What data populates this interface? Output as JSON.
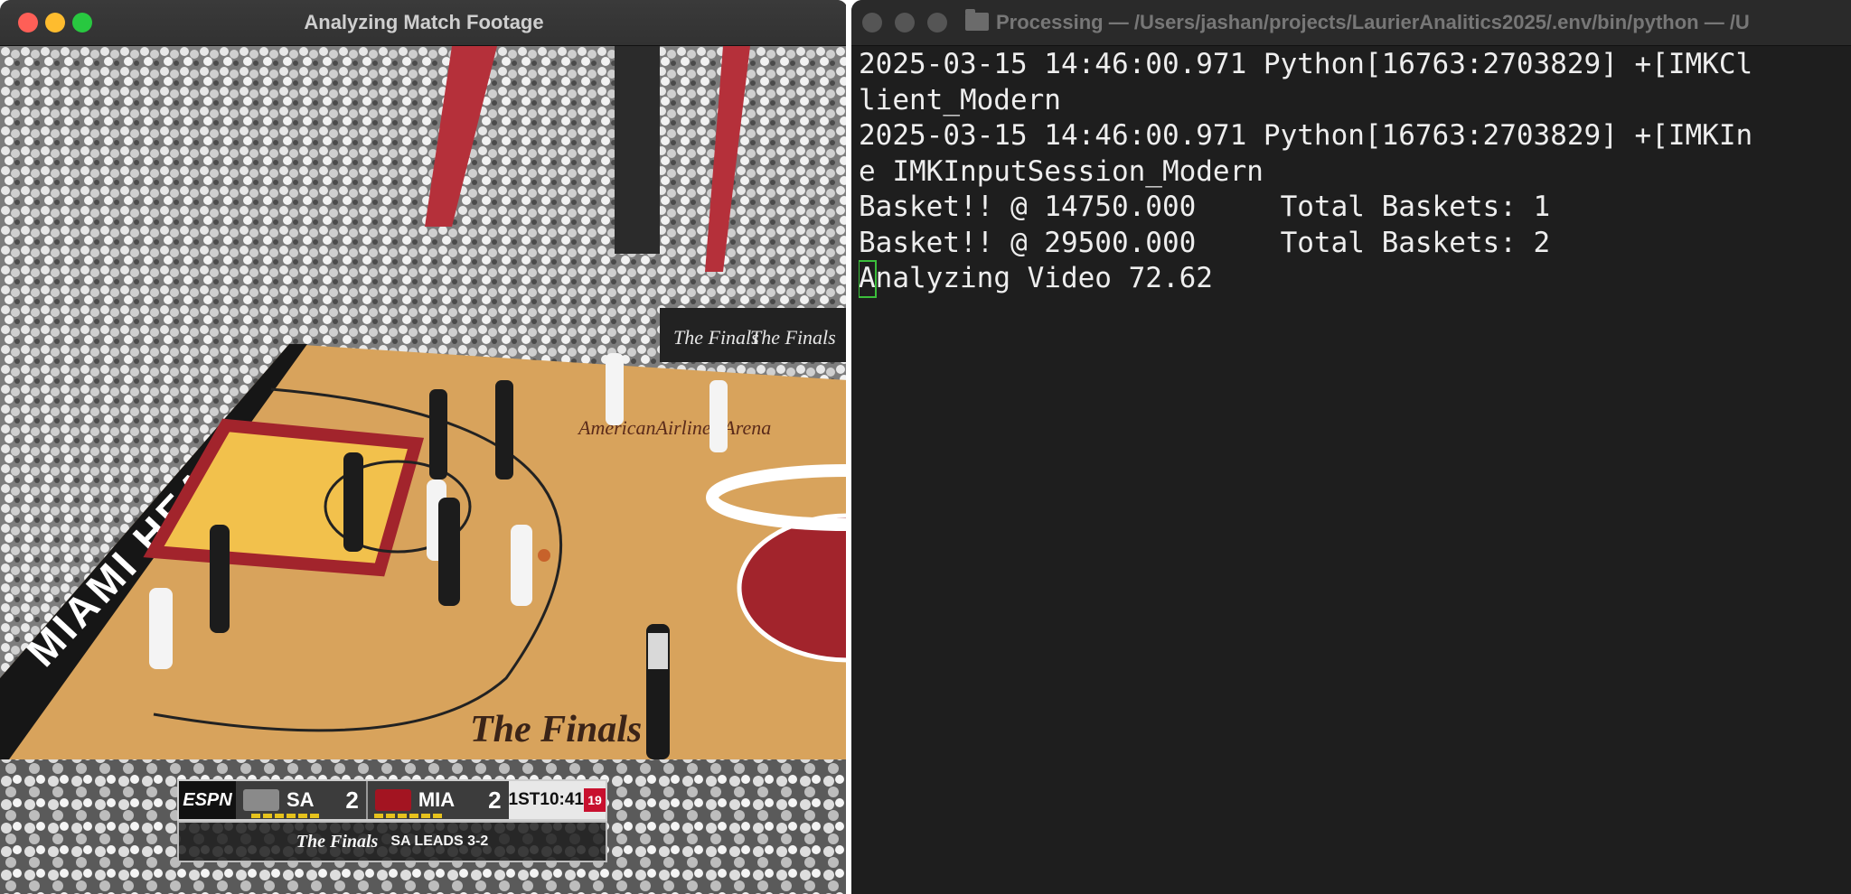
{
  "video_window": {
    "title": "Analyzing Match Footage",
    "court_text": {
      "baseline": "MIAMI HEAT",
      "center": "The Finals",
      "arena": "AmericanAirlines Arena",
      "sign_1": "The Finals",
      "sign_2": "The Finals"
    },
    "scorebug": {
      "network": "ESPN",
      "team_1": "SA",
      "score_1": "2",
      "team_2": "MIA",
      "score_2": "2",
      "period": "1ST",
      "clock": "10:41",
      "shot_clock": "19",
      "series_logo": "The Finals",
      "series_status": "SA LEADS 3-2"
    }
  },
  "terminal_window": {
    "title": "Processing — /Users/jashan/projects/LaurierAnalitics2025/.env/bin/python — /U",
    "lines": [
      "2025-03-15 14:46:00.971 Python[16763:2703829] +[IMKCl",
      "lient_Modern",
      "2025-03-15 14:46:00.971 Python[16763:2703829] +[IMKIn",
      "e IMKInputSession_Modern",
      "Basket!! @ 14750.000     Total Baskets: 1",
      "Basket!! @ 29500.000     Total Baskets: 2"
    ],
    "cursor_char": "A",
    "last_line_rest": "nalyzing Video 72.62"
  },
  "colors": {
    "court": "#d8a35c",
    "paint": "#f2c14c",
    "lane_red": "#a2242c",
    "terminal_bg": "#1e1e1e",
    "terminal_text": "#eeeeee",
    "cursor": "#3bbf3b"
  }
}
